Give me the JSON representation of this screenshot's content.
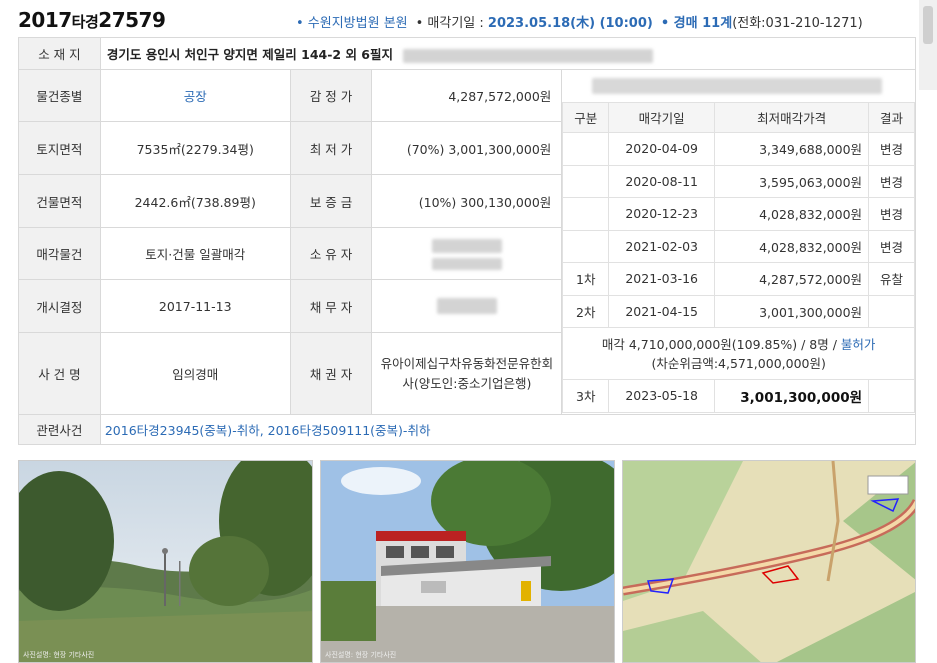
{
  "header": {
    "case_year": "2017",
    "case_type": "타경",
    "case_num": "27579",
    "court": "• 수원지방법원 본원",
    "sale_date_label": "• 매각기일 : ",
    "sale_date": "2023.05.18(木) (10:00)",
    "dept_label": "• 경매 11계",
    "phone": "(전화:031-210-1271)"
  },
  "location": {
    "label": "소 재 지",
    "value": "경기도 용인시 처인구 양지면 제일리 144-2 외 6필지"
  },
  "rows": [
    {
      "label": "물건종별",
      "value": "공장",
      "label2": "감 정 가",
      "value2": "4,287,572,000원"
    },
    {
      "label": "토지면적",
      "value": "7535㎡(2279.34평)",
      "label2": "최 저 가",
      "value2": "(70%) 3,001,300,000원"
    },
    {
      "label": "건물면적",
      "value": "2442.6㎡(738.89평)",
      "label2": "보 증 금",
      "value2": "(10%) 300,130,000원"
    },
    {
      "label": "매각물건",
      "value": "토지·건물 일괄매각",
      "label2": "소 유 자",
      "value2": ""
    },
    {
      "label": "개시결정",
      "value": "2017-11-13",
      "label2": "채 무 자",
      "value2": ""
    },
    {
      "label": "사 건 명",
      "value": "임의경매",
      "label2": "채 권 자",
      "value2": "유아이제십구차유동화전문유한회사(양도인:중소기업은행)"
    }
  ],
  "related": {
    "label": "관련사건",
    "value": "2016타경23945(중복)-취하, 2016타경509111(중복)-취하"
  },
  "history": {
    "headers": [
      "구분",
      "매각기일",
      "최저매각가격",
      "결과"
    ],
    "rows": [
      {
        "round": "",
        "date": "2020-04-09",
        "price": "3,349,688,000원",
        "result": "변경"
      },
      {
        "round": "",
        "date": "2020-08-11",
        "price": "3,595,063,000원",
        "result": "변경"
      },
      {
        "round": "",
        "date": "2020-12-23",
        "price": "4,028,832,000원",
        "result": "변경"
      },
      {
        "round": "",
        "date": "2021-02-03",
        "price": "4,028,832,000원",
        "result": "변경"
      },
      {
        "round": "1차",
        "date": "2021-03-16",
        "price": "4,287,572,000원",
        "result": "유찰"
      },
      {
        "round": "2차",
        "date": "2021-04-15",
        "price": "3,001,300,000원",
        "result": ""
      }
    ],
    "sale_summary": "매각 4,710,000,000원(109.85%) / 8명 / ",
    "sale_summary_link": "불허가",
    "second_bid": "(차순위금액:4,571,000,000원)",
    "current": {
      "round": "3차",
      "date": "2023-05-18",
      "price": "3,001,300,000원"
    }
  },
  "photos": {
    "captions": [
      "사진설명: 현장 기타사진",
      "사진설명: 현장 기타사진",
      ""
    ]
  }
}
